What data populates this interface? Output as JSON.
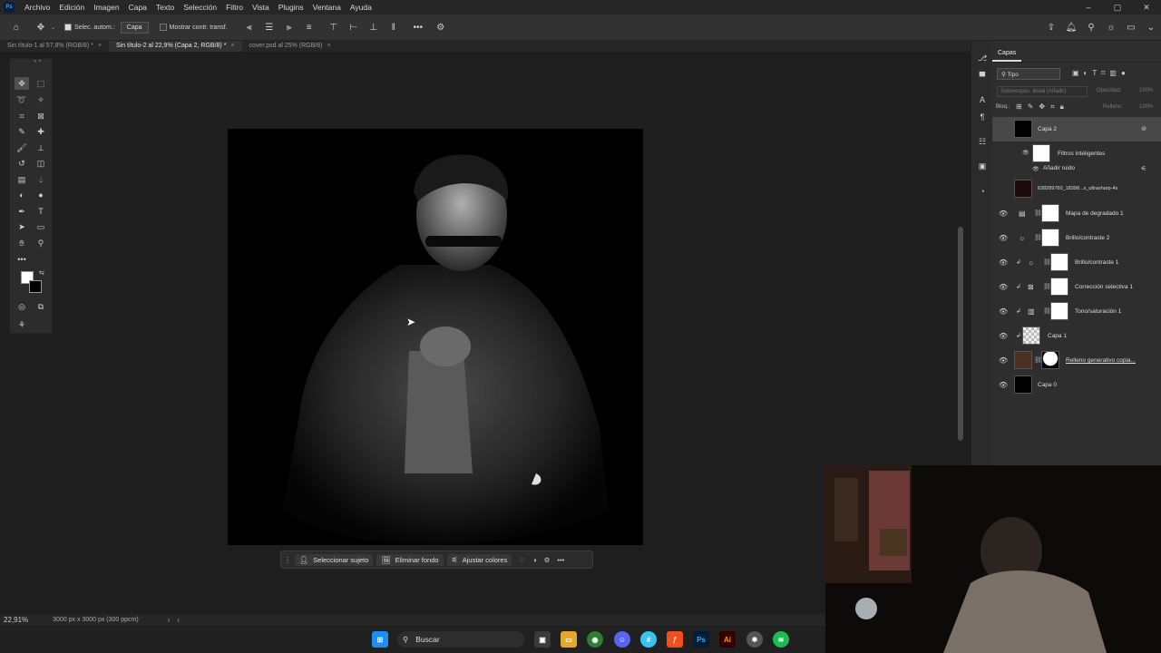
{
  "menubar": {
    "logo": "Ps",
    "items": [
      "Archivo",
      "Edición",
      "Imagen",
      "Capa",
      "Texto",
      "Selección",
      "Filtro",
      "Vista",
      "Plugins",
      "Ventana",
      "Ayuda"
    ],
    "window_controls": [
      "–",
      "▢",
      "✕"
    ]
  },
  "options": {
    "auto_select_label": "Selec. autom.:",
    "auto_select_value": "Capa",
    "show_transform_label": "Mostrar contr. transf."
  },
  "tabs": [
    {
      "label": "Sin título-1 al 57,8% (RGB/8) *",
      "active": false
    },
    {
      "label": "Sin título-2 al 22,9% (Capa 2, RGB/8) *",
      "active": true
    },
    {
      "label": "cover.psd al 25% (RGB/8)",
      "active": false
    }
  ],
  "contextbar": {
    "select_subject": "Seleccionar sujeto",
    "remove_bg": "Eliminar fondo",
    "adjust_colors": "Ajustar colores"
  },
  "status": {
    "zoom": "22,91%",
    "doc_info": "3000 px x 3000 px (300 ppcm)"
  },
  "layers_panel": {
    "title": "Capas",
    "filter_kind": "Tipo",
    "blend_mode": "Sobreexpos. lineal (Añadir)",
    "opacity_label": "Opacidad:",
    "opacity_value": "100%",
    "lock_label": "Bloq.:",
    "fill_label": "Relleno:",
    "fill_value": "100%",
    "layers": [
      {
        "name": "Capa 2",
        "visible": false,
        "selected": true
      },
      {
        "name": "Filtros inteligentes",
        "sub": true
      },
      {
        "name": "Añadir ruido",
        "sub2": true
      },
      {
        "name": "638289760_18398...x_ultrasharp-4x",
        "visible": false
      },
      {
        "name": "Mapa de degradado 1",
        "visible": true
      },
      {
        "name": "Brillo/contraste 2",
        "visible": true
      },
      {
        "name": "Brillo/contraste 1",
        "visible": true
      },
      {
        "name": "Corrección selectiva 1",
        "visible": true
      },
      {
        "name": "Tono/saturación 1",
        "visible": true
      },
      {
        "name": "Capa 1",
        "visible": true
      },
      {
        "name": "Relleno generativo copia...",
        "visible": true
      },
      {
        "name": "Capa 0",
        "visible": true
      }
    ]
  },
  "taskbar": {
    "search_label": "Buscar",
    "apps": [
      "Ps",
      "Ai"
    ]
  }
}
